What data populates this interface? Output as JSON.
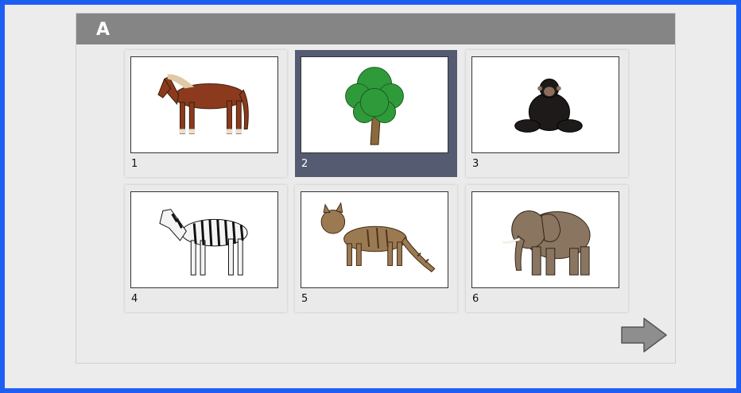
{
  "header": {
    "title": "A"
  },
  "cards": [
    {
      "label": "1",
      "image": "horse",
      "selected": false
    },
    {
      "label": "2",
      "image": "tree",
      "selected": true
    },
    {
      "label": "3",
      "image": "chimpanzee",
      "selected": false
    },
    {
      "label": "4",
      "image": "zebra",
      "selected": false
    },
    {
      "label": "5",
      "image": "wild-cat",
      "selected": false
    },
    {
      "label": "6",
      "image": "elephant",
      "selected": false
    }
  ],
  "navigation": {
    "next_icon": "arrow-right-icon"
  },
  "colors": {
    "frame_border": "#1f5ef3",
    "header_bg": "#858585",
    "selected_card": "#555b70"
  }
}
